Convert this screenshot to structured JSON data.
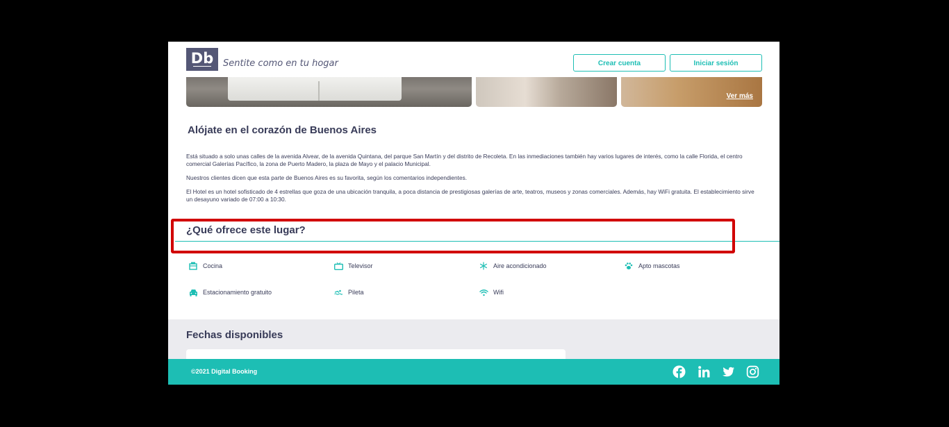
{
  "header": {
    "logo": "Db",
    "slogan": "Sentite como en tu hogar",
    "create_account": "Crear cuenta",
    "login": "Iniciar sesión"
  },
  "gallery": {
    "see_more": "Ver más"
  },
  "description": {
    "title": "Alójate en el corazón de Buenos Aires",
    "paragraphs": [
      "Está situado a solo unas calles de la avenida Alvear, de la avenida Quintana, del parque San Martín y del distrito de Recoleta. En las inmediaciones también hay varios lugares de interés, como la calle Florida, el centro comercial Galerías Pacífico, la zona de Puerto Madero, la plaza de Mayo y el palacio Municipal.",
      "Nuestros clientes dicen que esta parte de Buenos Aires es su favorita, según los comentarios independientes.",
      "El Hotel es un hotel sofisticado de 4 estrellas que goza de una ubicación tranquila, a poca distancia de prestigiosas galerías de arte, teatros, museos y zonas comerciales. Además, hay WiFi gratuita. El establecimiento sirve un desayuno variado de 07:00 a 10:30."
    ]
  },
  "features": {
    "title": "¿Qué ofrece este lugar?",
    "items": [
      {
        "label": "Cocina",
        "icon": "kitchen-icon"
      },
      {
        "label": "Televisor",
        "icon": "tv-icon"
      },
      {
        "label": "Aire acondicionado",
        "icon": "snowflake-icon"
      },
      {
        "label": "Apto mascotas",
        "icon": "paw-icon"
      },
      {
        "label": "Estacionamiento gratuito",
        "icon": "car-icon"
      },
      {
        "label": "Pileta",
        "icon": "swimmer-icon"
      },
      {
        "label": "Wifi",
        "icon": "wifi-icon"
      }
    ]
  },
  "dates": {
    "title": "Fechas disponibles"
  },
  "footer": {
    "copyright": "©2021 Digital Booking",
    "social": [
      "facebook-icon",
      "linkedin-icon",
      "twitter-icon",
      "instagram-icon"
    ]
  },
  "colors": {
    "primary": "#1dbeb4",
    "dark": "#383b58",
    "logo_bg": "#545776",
    "highlight": "#d10000"
  }
}
